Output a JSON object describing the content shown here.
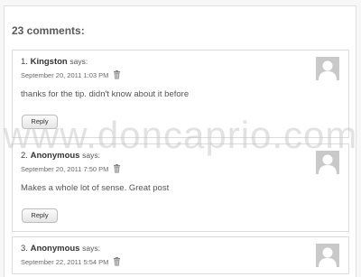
{
  "section": {
    "heading": "23 comments:"
  },
  "comments": [
    {
      "number": "1.",
      "author": "Kingston",
      "says": "says:",
      "date": "September 20, 2011 1:03 PM",
      "text": "thanks for the tip. didn't know about it before",
      "reply_label": "Reply"
    },
    {
      "number": "2.",
      "author": "Anonymous",
      "says": "says:",
      "date": "September 20, 2011 7:50 PM",
      "text": "Makes a whole lot of sense. Great post",
      "reply_label": "Reply"
    },
    {
      "number": "3.",
      "author": "Anonymous",
      "says": "says:",
      "date": "September 22, 2011 5:54 PM"
    }
  ],
  "watermark": "www.doncaprio.com",
  "icons": {
    "delete": "trash-icon",
    "avatar": "default-avatar-icon"
  },
  "colors": {
    "background": "#f7f7f7",
    "avatar": "#c9c9c9",
    "watermark": "#bebebe"
  }
}
